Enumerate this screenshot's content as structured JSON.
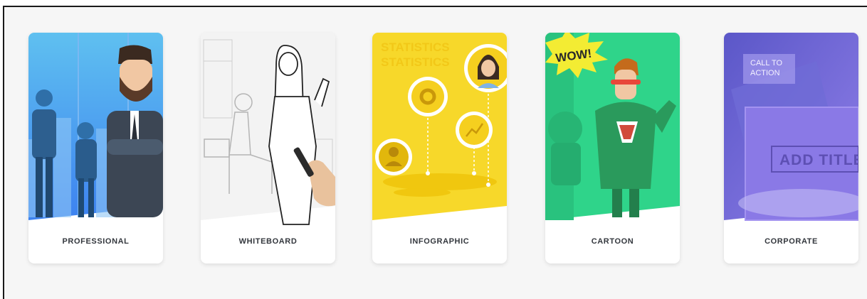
{
  "categories": [
    {
      "label": "PROFESSIONAL"
    },
    {
      "label": "WHITEBOARD"
    },
    {
      "label": "INFOGRAPHIC"
    },
    {
      "label": "CARTOON"
    },
    {
      "label": "CORPORATE"
    }
  ],
  "art_text": {
    "infographic_bg_word": "STATISTICS",
    "cartoon_burst": "WOW!",
    "corporate_cta": "CALL TO\nACTION",
    "corporate_title": "ADD TITLE"
  },
  "colors": {
    "professional": "#4aa3f5",
    "whiteboard": "#f3f3f3",
    "infographic": "#f7d82a",
    "cartoon": "#2fd48a",
    "corporate": "#7d6be0",
    "label_text": "#33373d"
  }
}
